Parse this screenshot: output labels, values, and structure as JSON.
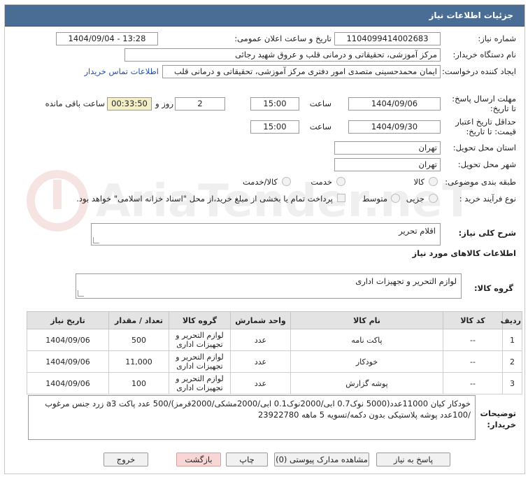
{
  "window": {
    "title": "جزئیات اطلاعات نیاز"
  },
  "fields": {
    "need_number_label": "شماره نیاز:",
    "need_number": "1104099414002683",
    "announce_label": "تاریخ و ساعت اعلان عمومی:",
    "announce_value": "1404/09/04 - 13:28",
    "buyer_org_label": "نام دستگاه خریدار:",
    "buyer_org": "مرکز آموزشی، تحقیقاتی و درمانی قلب و عروق شهید رجائی",
    "requester_label": "ایجاد کننده درخواست:",
    "requester": "ایمان محمدحسینی متصدی امور دفتری مرکز آموزشی، تحقیقاتی و درمانی قلب",
    "contact_link": "اطلاعات تماس خریدار",
    "deadline_label": "مهلت ارسال پاسخ: تا تاریخ:",
    "deadline_date": "1404/09/06",
    "time_label": "ساعت",
    "deadline_time": "15:00",
    "days_value": "2",
    "days_label": "روز و",
    "remaining_time": "00:33:50",
    "remaining_label": "ساعت باقی مانده",
    "validity_label": "حداقل تاریخ اعتبار قیمت: تا تاریخ:",
    "validity_date": "1404/09/30",
    "validity_time": "15:00",
    "province_label": "استان محل تحویل:",
    "province": "تهران",
    "city_label": "شهر محل تحویل:",
    "city": "تهران",
    "category_label": "طبقه بندی موضوعی:",
    "category_opts": [
      "کالا",
      "خدمت",
      "کالا/خدمت"
    ],
    "process_label": "نوع فرآیند خرید :",
    "process_opts": [
      "جزیی",
      "متوسط"
    ],
    "payment_note": "پرداخت تمام یا بخشی از مبلغ خرید،از محل \"اسناد خزانه اسلامی\" خواهد بود."
  },
  "summary": {
    "label": "شرح کلی نیاز:",
    "value": "اقلام تحریر"
  },
  "goods": {
    "heading": "اطلاعات کالاهای مورد نیاز",
    "group_label": "گروه کالا:",
    "group_value": "لوازم التحریر و تجهیزات اداری"
  },
  "table": {
    "headers": [
      "ردیف",
      "کد کالا",
      "نام کالا",
      "واحد شمارش",
      "گروه کالا",
      "تعداد / مقدار",
      "تاریخ نیاز"
    ],
    "rows": [
      [
        "1",
        "--",
        "پاکت نامه",
        "عدد",
        "لوازم التحریر و تجهیزات اداری",
        "500",
        "1404/09/06"
      ],
      [
        "2",
        "--",
        "خودکار",
        "عدد",
        "لوازم التحریر و تجهیزات اداری",
        "11,000",
        "1404/09/06"
      ],
      [
        "3",
        "--",
        "پوشه گزارش",
        "عدد",
        "لوازم التحریر و تجهیزات اداری",
        "100",
        "1404/09/06"
      ]
    ]
  },
  "buyer_notes": {
    "label": "توضیحات خریدار:",
    "line1": "خودکار کیان 11000عدد(5000 نوک0.7 ابی/2000نوک0.1 ابی/2000مشکی/2000قرمز)/500 عدد پاکت a3 زرد جنس مرغوب",
    "line2": "/100عدد پوشه پلاستیکی بدون دکمه/تسویه 5 ماهه 23922780"
  },
  "buttons": {
    "reply": "پاسخ به نیاز",
    "attachments": "مشاهده مدارک پیوستی (0)",
    "print": "چاپ",
    "back": "بازگشت",
    "exit": "خروج"
  },
  "watermark": "AriaTender.neT"
}
